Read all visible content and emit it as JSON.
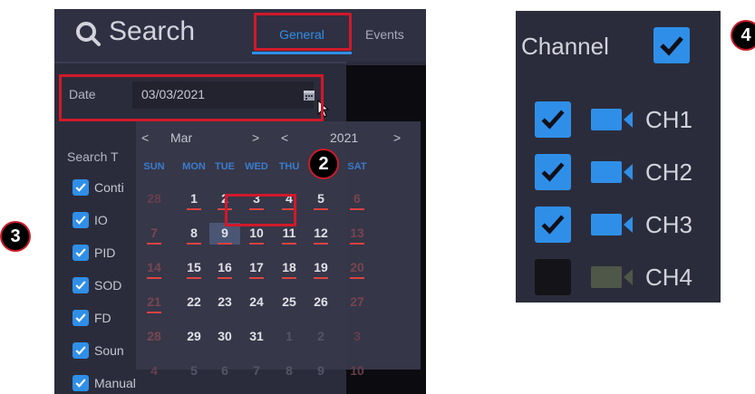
{
  "search_panel": {
    "title": "Search",
    "tabs": [
      {
        "label": "General",
        "active": true
      },
      {
        "label": "Events",
        "active": false
      }
    ],
    "date": {
      "label": "Date",
      "value": "03/03/2021"
    },
    "search_type": {
      "label": "Search T",
      "items": [
        {
          "label": "Conti",
          "checked": true
        },
        {
          "label": "IO",
          "checked": true
        },
        {
          "label": "PID",
          "checked": true
        },
        {
          "label": "SOD",
          "checked": true
        },
        {
          "label": "FD",
          "checked": true
        },
        {
          "label": "Soun",
          "checked": true
        },
        {
          "label": "Manual",
          "checked": true
        }
      ]
    },
    "calendar": {
      "month": "Mar",
      "year": "2021",
      "prev": "<",
      "next": ">",
      "weekdays": [
        "SUN",
        "MON",
        "TUE",
        "WED",
        "THU",
        "FRI",
        "SAT"
      ],
      "weeks": [
        [
          {
            "d": "28",
            "m": "other"
          },
          {
            "d": "1",
            "m": "cur",
            "rec": true
          },
          {
            "d": "2",
            "m": "cur",
            "rec": true
          },
          {
            "d": "3",
            "m": "cur",
            "rec": true
          },
          {
            "d": "4",
            "m": "cur",
            "rec": true
          },
          {
            "d": "5",
            "m": "cur",
            "rec": true
          },
          {
            "d": "6",
            "m": "cur",
            "rec": true
          }
        ],
        [
          {
            "d": "7",
            "m": "cur",
            "rec": true
          },
          {
            "d": "8",
            "m": "cur",
            "rec": true
          },
          {
            "d": "9",
            "m": "cur",
            "rec": true,
            "today": true
          },
          {
            "d": "10",
            "m": "cur",
            "rec": true
          },
          {
            "d": "11",
            "m": "cur",
            "rec": true
          },
          {
            "d": "12",
            "m": "cur",
            "rec": true
          },
          {
            "d": "13",
            "m": "cur",
            "rec": true
          }
        ],
        [
          {
            "d": "14",
            "m": "cur",
            "rec": true
          },
          {
            "d": "15",
            "m": "cur",
            "rec": true
          },
          {
            "d": "16",
            "m": "cur",
            "rec": true
          },
          {
            "d": "17",
            "m": "cur",
            "rec": true
          },
          {
            "d": "18",
            "m": "cur",
            "rec": true
          },
          {
            "d": "19",
            "m": "cur",
            "rec": true
          },
          {
            "d": "20",
            "m": "cur",
            "rec": true
          }
        ],
        [
          {
            "d": "21",
            "m": "cur",
            "rec": true
          },
          {
            "d": "22",
            "m": "cur"
          },
          {
            "d": "23",
            "m": "cur"
          },
          {
            "d": "24",
            "m": "cur"
          },
          {
            "d": "25",
            "m": "cur"
          },
          {
            "d": "26",
            "m": "cur"
          },
          {
            "d": "27",
            "m": "cur"
          }
        ],
        [
          {
            "d": "28",
            "m": "cur"
          },
          {
            "d": "29",
            "m": "cur"
          },
          {
            "d": "30",
            "m": "cur"
          },
          {
            "d": "31",
            "m": "cur"
          },
          {
            "d": "1",
            "m": "other"
          },
          {
            "d": "2",
            "m": "other"
          },
          {
            "d": "3",
            "m": "other"
          }
        ],
        [
          {
            "d": "4",
            "m": "other"
          },
          {
            "d": "5",
            "m": "other"
          },
          {
            "d": "6",
            "m": "other"
          },
          {
            "d": "7",
            "m": "other"
          },
          {
            "d": "8",
            "m": "other"
          },
          {
            "d": "9",
            "m": "other"
          },
          {
            "d": "10",
            "m": "other"
          }
        ]
      ]
    }
  },
  "channel_panel": {
    "title": "Channel",
    "all_checked": true,
    "channels": [
      {
        "label": "CH1",
        "checked": true
      },
      {
        "label": "CH2",
        "checked": true
      },
      {
        "label": "CH3",
        "checked": true
      },
      {
        "label": "CH4",
        "checked": false
      }
    ]
  },
  "markers": [
    "2",
    "3",
    "4"
  ],
  "colors": {
    "accent": "#2f8fe8",
    "highlight": "#d0192a",
    "panel_bg": "#2b2c3b",
    "record_mark": "#e34444"
  },
  "icons": [
    "search-icon",
    "calendar-icon",
    "cursor-icon",
    "check-icon",
    "camera-icon"
  ]
}
